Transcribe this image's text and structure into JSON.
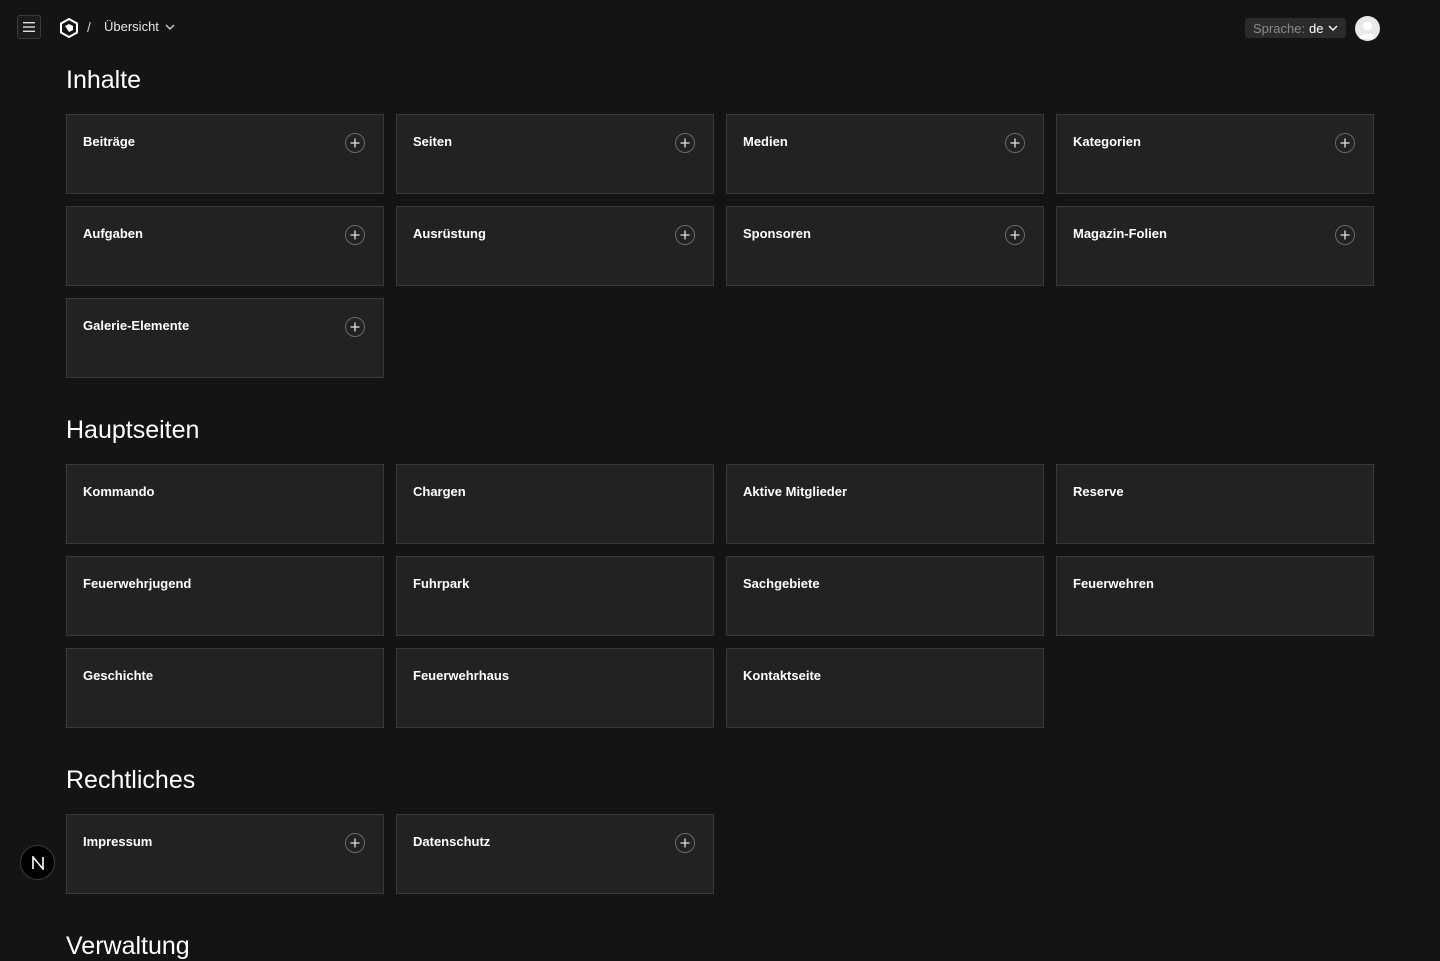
{
  "topbar": {
    "breadcrumb_separator": "/",
    "breadcrumb_current": "Übersicht",
    "language_label": "Sprache:",
    "language_value": "de"
  },
  "sections": [
    {
      "title": "Inhalte",
      "cards": [
        {
          "label": "Beiträge",
          "has_add": true
        },
        {
          "label": "Seiten",
          "has_add": true
        },
        {
          "label": "Medien",
          "has_add": true
        },
        {
          "label": "Kategorien",
          "has_add": true
        },
        {
          "label": "Aufgaben",
          "has_add": true
        },
        {
          "label": "Ausrüstung",
          "has_add": true
        },
        {
          "label": "Sponsoren",
          "has_add": true
        },
        {
          "label": "Magazin-Folien",
          "has_add": true
        },
        {
          "label": "Galerie-Elemente",
          "has_add": true
        }
      ]
    },
    {
      "title": "Hauptseiten",
      "cards": [
        {
          "label": "Kommando",
          "has_add": false
        },
        {
          "label": "Chargen",
          "has_add": false
        },
        {
          "label": "Aktive Mitglieder",
          "has_add": false
        },
        {
          "label": "Reserve",
          "has_add": false
        },
        {
          "label": "Feuerwehrjugend",
          "has_add": false
        },
        {
          "label": "Fuhrpark",
          "has_add": false
        },
        {
          "label": "Sachgebiete",
          "has_add": false
        },
        {
          "label": "Feuerwehren",
          "has_add": false
        },
        {
          "label": "Geschichte",
          "has_add": false
        },
        {
          "label": "Feuerwehrhaus",
          "has_add": false
        },
        {
          "label": "Kontaktseite",
          "has_add": false
        }
      ]
    },
    {
      "title": "Rechtliches",
      "cards": [
        {
          "label": "Impressum",
          "has_add": true
        },
        {
          "label": "Datenschutz",
          "has_add": true
        }
      ]
    },
    {
      "title": "Verwaltung",
      "cards": []
    }
  ],
  "next_badge_letter": "N"
}
